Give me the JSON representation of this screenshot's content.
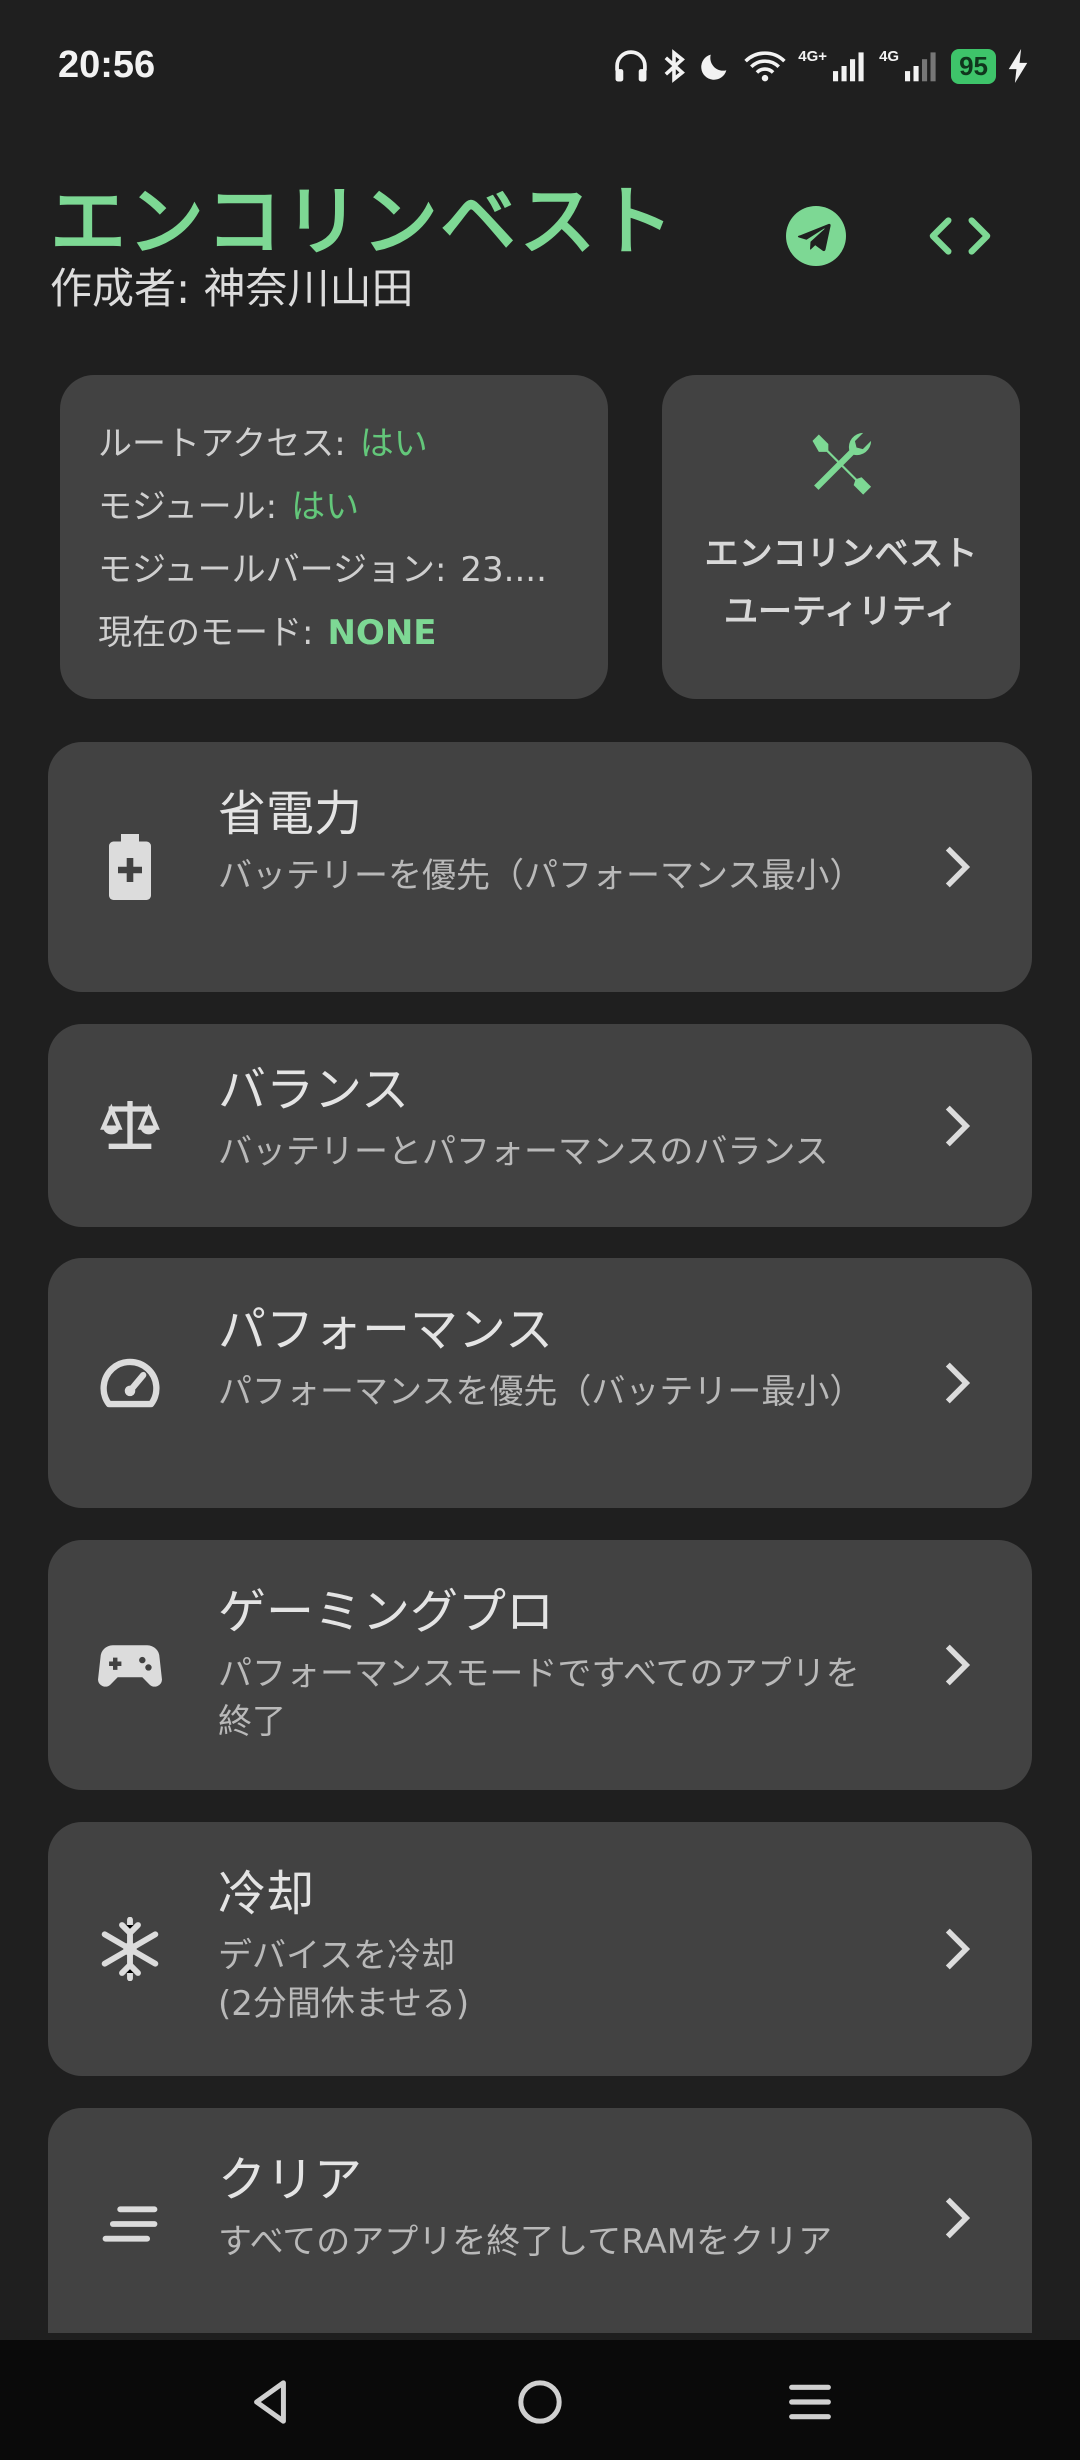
{
  "status_bar": {
    "time": "20:56",
    "icons": [
      "headphones-icon",
      "bluetooth-icon",
      "moon-icon",
      "wifi-icon",
      "signal-4g-plus-icon",
      "signal-4g-icon"
    ],
    "signal_labels": [
      "4G+",
      "4G"
    ],
    "battery": "95"
  },
  "header": {
    "title": "エンコリンベスト",
    "author": "作成者: 神奈川山田",
    "accent_color": "#7dd894"
  },
  "info_card": {
    "rows": [
      {
        "label": "ルートアクセス:",
        "value": "はい"
      },
      {
        "label": "モジュール:",
        "value": "はい"
      },
      {
        "label": "モジュールバージョン:",
        "value": "23...."
      },
      {
        "label": "現在のモード:",
        "value": "NONE"
      }
    ]
  },
  "utility_card": {
    "line1": "エンコリンベスト",
    "line2": "ユーティリティ"
  },
  "modes": [
    {
      "title": "省電力",
      "desc": "バッテリーを優先（パフォーマンス最小）",
      "icon": "battery-plus-icon"
    },
    {
      "title": "バランス",
      "desc": "バッテリーとパフォーマンスのバランス",
      "icon": "scale-icon"
    },
    {
      "title": "パフォーマンス",
      "desc": "パフォーマンスを優先（バッテリー最小）",
      "icon": "speedometer-icon"
    },
    {
      "title": "ゲーミングプロ",
      "desc": "パフォーマンスモードですべてのアプリを終了",
      "icon": "gamepad-icon"
    },
    {
      "title": "冷却",
      "desc": "デバイスを冷却\n(2分間休ませる)",
      "icon": "snowflake-icon"
    },
    {
      "title": "クリア",
      "desc": "すべてのアプリを終了してRAMをクリア",
      "icon": "clear-lines-icon"
    }
  ],
  "nav_bar": {
    "buttons": [
      "back-icon",
      "home-icon",
      "menu-icon"
    ]
  }
}
